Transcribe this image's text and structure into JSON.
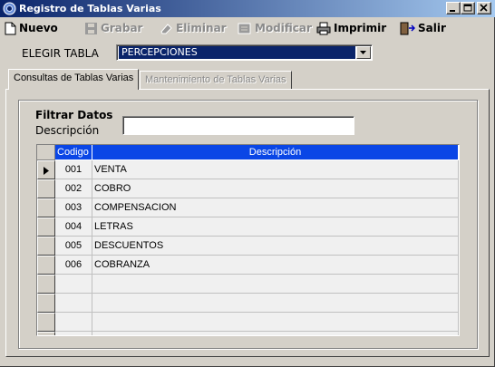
{
  "window": {
    "title": "Registro de Tablas Varias"
  },
  "toolbar": {
    "nuevo": "Nuevo",
    "grabar": "Grabar",
    "eliminar": "Eliminar",
    "modificar": "Modificar",
    "imprimir": "Imprimir",
    "salir": "Salir"
  },
  "selector": {
    "label": "ELEGIR TABLA",
    "value": "PERCEPCIONES"
  },
  "tabs": [
    {
      "label": "Consultas de Tablas Varias",
      "state": "active"
    },
    {
      "label": "Mantenimiento de Tablas Varias",
      "state": "disabled"
    }
  ],
  "filter": {
    "heading": "Filtrar Datos",
    "label": "Descripción",
    "value": ""
  },
  "grid": {
    "columns": [
      "Codigo",
      "Descripción"
    ],
    "rows": [
      {
        "codigo": "001",
        "descripcion": "VENTA"
      },
      {
        "codigo": "002",
        "descripcion": "COBRO"
      },
      {
        "codigo": "003",
        "descripcion": "COMPENSACION"
      },
      {
        "codigo": "004",
        "descripcion": "LETRAS"
      },
      {
        "codigo": "005",
        "descripcion": "DESCUENTOS"
      },
      {
        "codigo": "006",
        "descripcion": "COBRANZA"
      }
    ],
    "empty_rows": 4,
    "selected_row": 0
  },
  "colors": {
    "titlebar": "#0a246a",
    "selection": "#0a246a",
    "grid_header": "#0a46e6",
    "face": "#d4d0c8"
  }
}
